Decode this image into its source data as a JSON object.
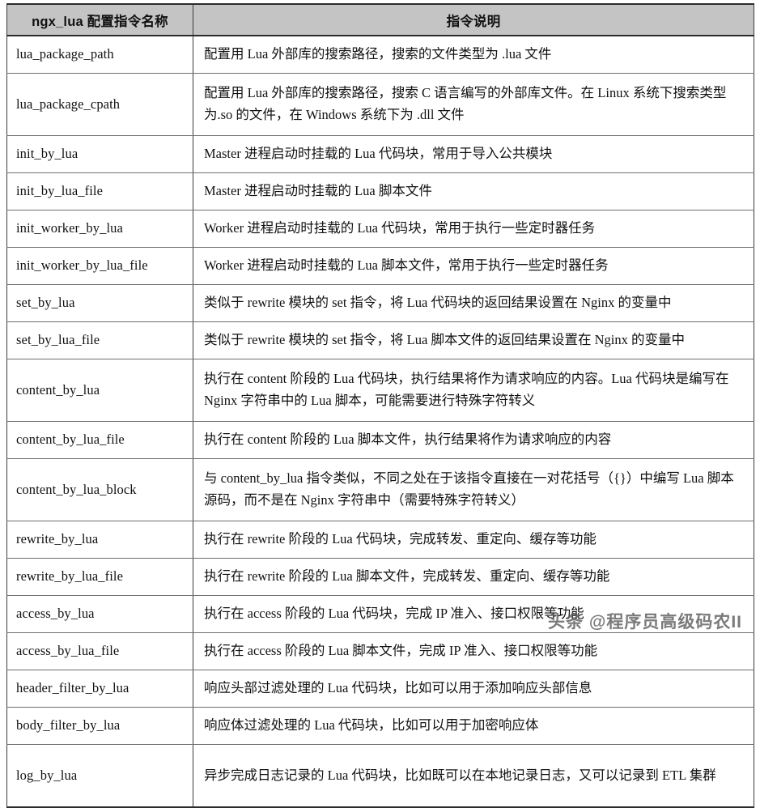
{
  "table": {
    "headers": {
      "name": "ngx_lua 配置指令名称",
      "description": "指令说明"
    },
    "rows": [
      {
        "name": "lua_package_path",
        "description": "配置用 Lua 外部库的搜索路径，搜索的文件类型为 .lua 文件",
        "tall": false
      },
      {
        "name": "lua_package_cpath",
        "description": "配置用 Lua 外部库的搜索路径，搜索 C 语言编写的外部库文件。在 Linux 系统下搜索类型为.so 的文件，在 Windows 系统下为 .dll 文件",
        "tall": true
      },
      {
        "name": "init_by_lua",
        "description": "Master 进程启动时挂载的 Lua 代码块，常用于导入公共模块",
        "tall": false
      },
      {
        "name": "init_by_lua_file",
        "description": "Master 进程启动时挂载的 Lua 脚本文件",
        "tall": false
      },
      {
        "name": "init_worker_by_lua",
        "description": "Worker 进程启动时挂载的 Lua 代码块，常用于执行一些定时器任务",
        "tall": false
      },
      {
        "name": "init_worker_by_lua_file",
        "description": "Worker 进程启动时挂载的 Lua 脚本文件，常用于执行一些定时器任务",
        "tall": false
      },
      {
        "name": "set_by_lua",
        "description": "类似于 rewrite 模块的 set 指令，将 Lua 代码块的返回结果设置在 Nginx 的变量中",
        "tall": false
      },
      {
        "name": "set_by_lua_file",
        "description": "类似于 rewrite 模块的 set 指令，将 Lua 脚本文件的返回结果设置在 Nginx 的变量中",
        "tall": false
      },
      {
        "name": "content_by_lua",
        "description": "执行在 content 阶段的 Lua 代码块，执行结果将作为请求响应的内容。Lua 代码块是编写在 Nginx 字符串中的 Lua 脚本，可能需要进行特殊字符转义",
        "tall": true
      },
      {
        "name": "content_by_lua_file",
        "description": "执行在 content 阶段的 Lua 脚本文件，执行结果将作为请求响应的内容",
        "tall": false
      },
      {
        "name": "content_by_lua_block",
        "description": "与 content_by_lua 指令类似，不同之处在于该指令直接在一对花括号（{}）中编写 Lua 脚本源码，而不是在 Nginx 字符串中（需要特殊字符转义）",
        "tall": true
      },
      {
        "name": "rewrite_by_lua",
        "description": "执行在 rewrite 阶段的 Lua 代码块，完成转发、重定向、缓存等功能",
        "tall": false
      },
      {
        "name": "rewrite_by_lua_file",
        "description": "执行在 rewrite 阶段的 Lua 脚本文件，完成转发、重定向、缓存等功能",
        "tall": false
      },
      {
        "name": "access_by_lua",
        "description": "执行在 access 阶段的 Lua 代码块，完成 IP 准入、接口权限等功能",
        "tall": false
      },
      {
        "name": "access_by_lua_file",
        "description": "执行在 access 阶段的 Lua 脚本文件，完成 IP 准入、接口权限等功能",
        "tall": false
      },
      {
        "name": "header_filter_by_lua",
        "description": "响应头部过滤处理的 Lua 代码块，比如可以用于添加响应头部信息",
        "tall": false
      },
      {
        "name": "body_filter_by_lua",
        "description": "响应体过滤处理的 Lua 代码块，比如可以用于加密响应体",
        "tall": false
      },
      {
        "name": "log_by_lua",
        "description": "异步完成日志记录的 Lua 代码块，比如既可以在本地记录日志，又可以记录到 ETL 集群",
        "tall": true
      }
    ]
  },
  "watermark": {
    "text": "头条 @程序员高级码农II"
  },
  "colors": {
    "header_background": "#c4c4c4",
    "border": "#3a3a3a",
    "text": "#111111",
    "watermark": "#5d5d5d"
  }
}
